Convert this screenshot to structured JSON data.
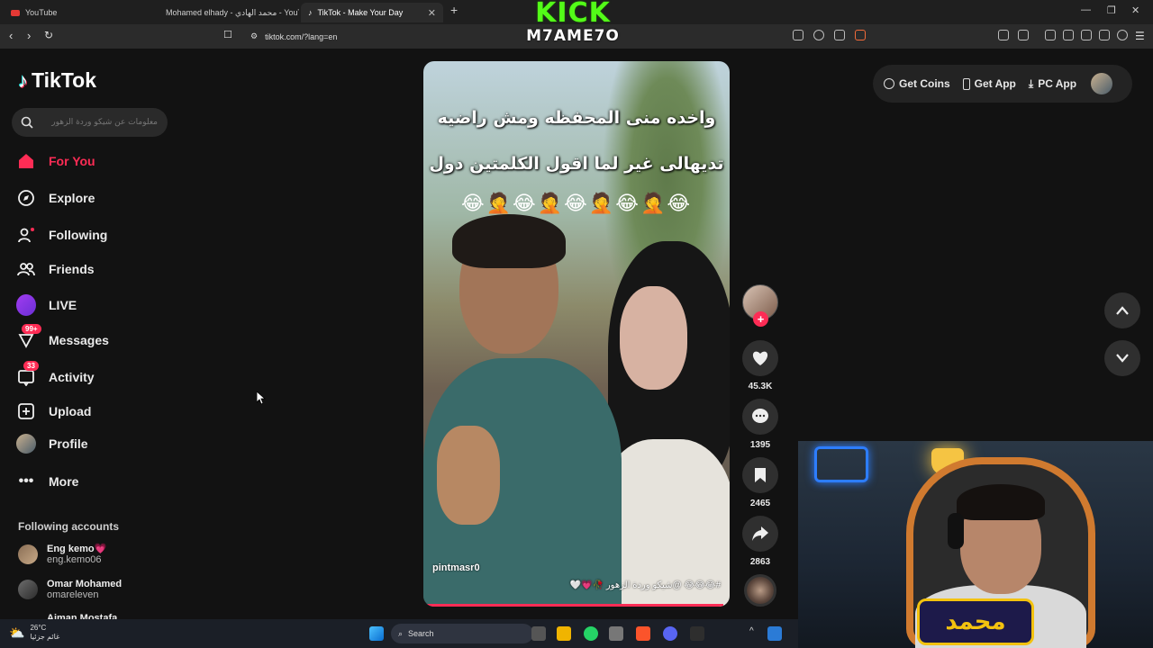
{
  "browser": {
    "tabs": [
      {
        "title": "YouTube"
      },
      {
        "title": "Mohamed elhady - محمد الهادي - YouTube"
      },
      {
        "title": "TikTok - Make Your Day"
      }
    ],
    "url": "tiktok.com/?lang=en"
  },
  "overlay": {
    "brand_top": "KICK",
    "brand_bottom": "M7AME7O"
  },
  "sidebar": {
    "logo": "TikTok",
    "search_placeholder": "معلومات عن شيكو وردة الزهور",
    "items": [
      {
        "label": "For You",
        "icon": "home-icon"
      },
      {
        "label": "Explore",
        "icon": "compass-icon"
      },
      {
        "label": "Following",
        "icon": "following-icon"
      },
      {
        "label": "Friends",
        "icon": "friends-icon"
      },
      {
        "label": "LIVE",
        "icon": "live-icon"
      },
      {
        "label": "Messages",
        "icon": "messages-icon",
        "badge": "99+"
      },
      {
        "label": "Activity",
        "icon": "activity-icon",
        "badge": "33"
      },
      {
        "label": "Upload",
        "icon": "upload-icon"
      },
      {
        "label": "Profile",
        "icon": "profile-icon"
      },
      {
        "label": "More",
        "icon": "more-icon"
      }
    ],
    "following_title": "Following accounts",
    "accounts": [
      {
        "name": "Eng kemo💗",
        "handle": "eng.kemo06"
      },
      {
        "name": "Omar Mohamed",
        "handle": "omareleven"
      },
      {
        "name": "Aiman Mostafa",
        "handle": ""
      }
    ]
  },
  "video": {
    "caption_line1": "واخده منى المحفظه ومش راضيه",
    "caption_line2": "تديهالى غير لما اقول الكلمتين دول",
    "emojis": "😂🤦😂🤦😂🤦😂🤦😂",
    "author": "pintmasr0",
    "description": "#😂😂😂 @شيكو وردة الزهور 🥀💗🤍",
    "progress": 0.98
  },
  "actions": {
    "likes": "45.3K",
    "comments": "1395",
    "saves": "2465",
    "shares": "2863"
  },
  "topbar": {
    "coins": "Get Coins",
    "app": "Get App",
    "pc": "PC App"
  },
  "taskbar": {
    "temp": "26°C",
    "weather_text": "غائم جزئيا",
    "search": "Search"
  },
  "webcam": {
    "logo_text": "محمد"
  },
  "colors": {
    "accent": "#fe2c55",
    "kick": "#53fc18",
    "bg": "#121212"
  }
}
